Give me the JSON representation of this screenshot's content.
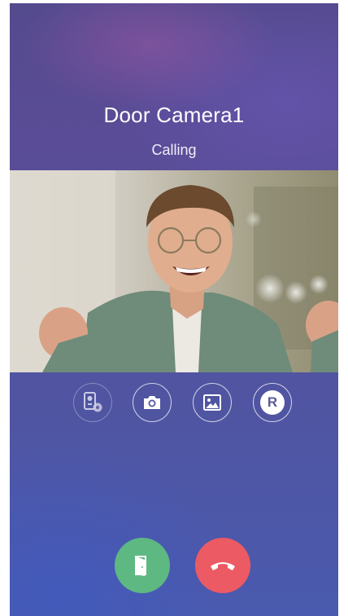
{
  "call": {
    "device_name": "Door Camera1",
    "status": "Calling"
  },
  "controls": [
    {
      "name": "monitor-switch",
      "icon": "door-camera-settings-icon"
    },
    {
      "name": "capture",
      "icon": "camera-icon"
    },
    {
      "name": "gallery",
      "icon": "image-icon"
    },
    {
      "name": "record",
      "icon": "record-icon",
      "label": "R"
    }
  ],
  "actions": {
    "unlock": {
      "icon": "door-open-icon",
      "color": "#5db882"
    },
    "hangup": {
      "icon": "phone-hangup-icon",
      "color": "#ec5a63"
    }
  },
  "colors": {
    "background": "#544a8e",
    "text": "#ffffff"
  }
}
